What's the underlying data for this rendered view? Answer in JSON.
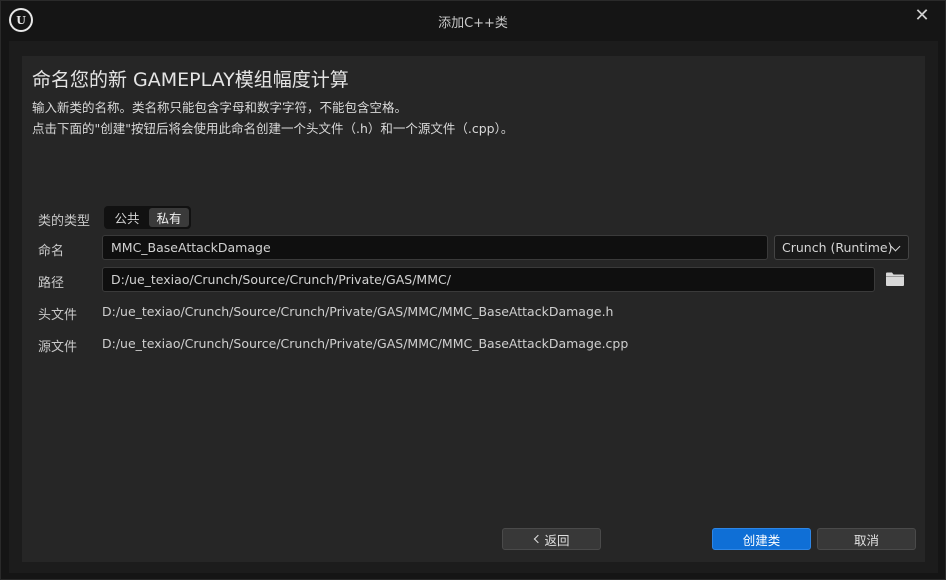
{
  "window": {
    "title": "添加C++类",
    "logo_text": "U"
  },
  "header": {
    "title": "命名您的新 GAMEPLAY模组幅度计算",
    "desc_line1": "输入新类的名称。类名称只能包含字母和数字字符，不能包含空格。",
    "desc_line2": "点击下面的\"创建\"按钮后将会使用此命名创建一个头文件（.h）和一个源文件（.cpp）。"
  },
  "form": {
    "class_type_label": "类的类型",
    "class_type_options": [
      "公共",
      "私有"
    ],
    "class_type_selected": "私有",
    "name_label": "命名",
    "name_value": "MMC_BaseAttackDamage",
    "module_value": "Crunch (Runtime)",
    "path_label": "路径",
    "path_value": "D:/ue_texiao/Crunch/Source/Crunch/Private/GAS/MMC/",
    "header_label": "头文件",
    "header_value": "D:/ue_texiao/Crunch/Source/Crunch/Private/GAS/MMC/MMC_BaseAttackDamage.h",
    "source_label": "源文件",
    "source_value": "D:/ue_texiao/Crunch/Source/Crunch/Private/GAS/MMC/MMC_BaseAttackDamage.cpp"
  },
  "footer": {
    "back_label": "返回",
    "create_label": "创建类",
    "cancel_label": "取消"
  },
  "icons": {
    "close": "close-icon",
    "folder": "folder-icon",
    "chevron": "chevron-down-icon",
    "back": "chevron-left-icon"
  },
  "colors": {
    "accent": "#0f6fd6",
    "panel": "#262626",
    "background": "#151515"
  }
}
